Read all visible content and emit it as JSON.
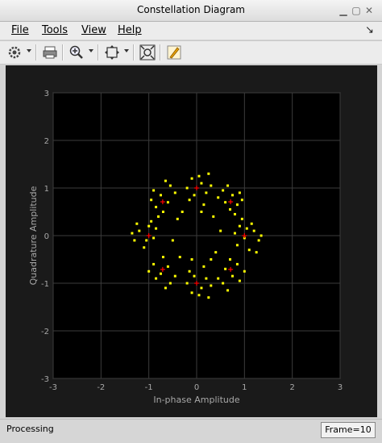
{
  "window": {
    "title": "Constellation Diagram"
  },
  "menu": {
    "items": [
      {
        "label": "File",
        "underline_index": 0
      },
      {
        "label": "Tools",
        "underline_index": 0
      },
      {
        "label": "View",
        "underline_index": 0
      },
      {
        "label": "Help",
        "underline_index": 0
      }
    ],
    "overflow_icon": "curved-arrow-icon"
  },
  "toolbar": {
    "icons": [
      "gear-icon",
      "print-icon",
      "zoom-in-icon",
      "pan-fit-icon",
      "autoscale-icon",
      "style-icon"
    ]
  },
  "status": {
    "left": "Processing",
    "right": "Frame=10"
  },
  "colors": {
    "background": "#000000",
    "grid": "#3c3c3c",
    "points": "#ffff00",
    "reference": "#ff0000",
    "axis_text": "#a8a8a8"
  },
  "chart_data": {
    "type": "scatter",
    "title": "",
    "xlabel": "In-phase Amplitude",
    "ylabel": "Quadrature Amplitude",
    "xlim": [
      -3,
      3
    ],
    "ylim": [
      -3,
      3
    ],
    "xticks": [
      -3,
      -2,
      -1,
      0,
      1,
      2,
      3
    ],
    "yticks": [
      -3,
      -2,
      -1,
      0,
      1,
      2,
      3
    ],
    "grid": true,
    "reference": [
      [
        1,
        0
      ],
      [
        0.71,
        0.71
      ],
      [
        0,
        1
      ],
      [
        -0.71,
        0.71
      ],
      [
        -1,
        0
      ],
      [
        -0.71,
        -0.71
      ],
      [
        0,
        -1
      ],
      [
        0.71,
        -0.71
      ]
    ],
    "series": [
      {
        "points": [
          [
            1.2,
            0.1
          ],
          [
            1.3,
            -0.1
          ],
          [
            1.1,
            -0.3
          ],
          [
            0.9,
            0.2
          ],
          [
            1.0,
            -0.05
          ],
          [
            0.85,
            -0.2
          ],
          [
            1.15,
            0.25
          ],
          [
            1.25,
            -0.35
          ],
          [
            0.95,
            0.35
          ],
          [
            0.8,
            0.05
          ],
          [
            1.35,
            0.0
          ],
          [
            1.05,
            0.15
          ],
          [
            0.75,
            0.85
          ],
          [
            0.6,
            0.7
          ],
          [
            0.85,
            0.65
          ],
          [
            0.9,
            0.9
          ],
          [
            0.55,
            0.95
          ],
          [
            0.7,
            0.55
          ],
          [
            0.95,
            0.75
          ],
          [
            0.45,
            0.8
          ],
          [
            0.65,
            1.05
          ],
          [
            0.8,
            0.45
          ],
          [
            0.1,
            1.1
          ],
          [
            -0.1,
            1.2
          ],
          [
            0.2,
            0.9
          ],
          [
            -0.05,
            0.85
          ],
          [
            0.25,
            1.3
          ],
          [
            -0.2,
            1.0
          ],
          [
            0.05,
            1.25
          ],
          [
            0.3,
            1.05
          ],
          [
            -0.15,
            0.75
          ],
          [
            0.15,
            0.65
          ],
          [
            -0.75,
            0.85
          ],
          [
            -0.6,
            0.7
          ],
          [
            -0.85,
            0.6
          ],
          [
            -0.9,
            0.95
          ],
          [
            -0.55,
            1.05
          ],
          [
            -0.7,
            0.5
          ],
          [
            -0.95,
            0.75
          ],
          [
            -0.45,
            0.9
          ],
          [
            -0.65,
            1.15
          ],
          [
            -0.8,
            0.4
          ],
          [
            -1.2,
            0.1
          ],
          [
            -1.3,
            -0.1
          ],
          [
            -1.0,
            0.2
          ],
          [
            -0.9,
            -0.05
          ],
          [
            -1.1,
            -0.25
          ],
          [
            -1.25,
            0.25
          ],
          [
            -0.85,
            0.15
          ],
          [
            -1.35,
            0.05
          ],
          [
            -1.05,
            -0.1
          ],
          [
            -0.95,
            0.3
          ],
          [
            -0.75,
            -0.8
          ],
          [
            -0.6,
            -0.65
          ],
          [
            -0.9,
            -0.6
          ],
          [
            -0.85,
            -0.9
          ],
          [
            -0.55,
            -1.0
          ],
          [
            -0.7,
            -0.45
          ],
          [
            -1.0,
            -0.75
          ],
          [
            -0.45,
            -0.85
          ],
          [
            -0.65,
            -1.1
          ],
          [
            0.1,
            -1.1
          ],
          [
            -0.1,
            -1.2
          ],
          [
            0.2,
            -0.9
          ],
          [
            -0.05,
            -0.85
          ],
          [
            0.25,
            -1.3
          ],
          [
            -0.2,
            -1.0
          ],
          [
            0.05,
            -1.25
          ],
          [
            0.3,
            -1.05
          ],
          [
            -0.15,
            -0.75
          ],
          [
            0.15,
            -0.65
          ],
          [
            0.75,
            -0.85
          ],
          [
            0.6,
            -0.7
          ],
          [
            0.85,
            -0.6
          ],
          [
            0.9,
            -0.95
          ],
          [
            0.55,
            -1.0
          ],
          [
            0.7,
            -0.5
          ],
          [
            1.0,
            -0.75
          ],
          [
            0.45,
            -0.9
          ],
          [
            0.65,
            -1.15
          ],
          [
            0.35,
            0.4
          ],
          [
            0.4,
            -0.35
          ],
          [
            -0.4,
            0.35
          ],
          [
            -0.35,
            -0.45
          ],
          [
            0.5,
            0.1
          ],
          [
            -0.5,
            -0.1
          ],
          [
            0.1,
            0.5
          ],
          [
            -0.1,
            -0.5
          ],
          [
            0.3,
            -0.5
          ],
          [
            -0.3,
            0.5
          ]
        ]
      }
    ]
  }
}
